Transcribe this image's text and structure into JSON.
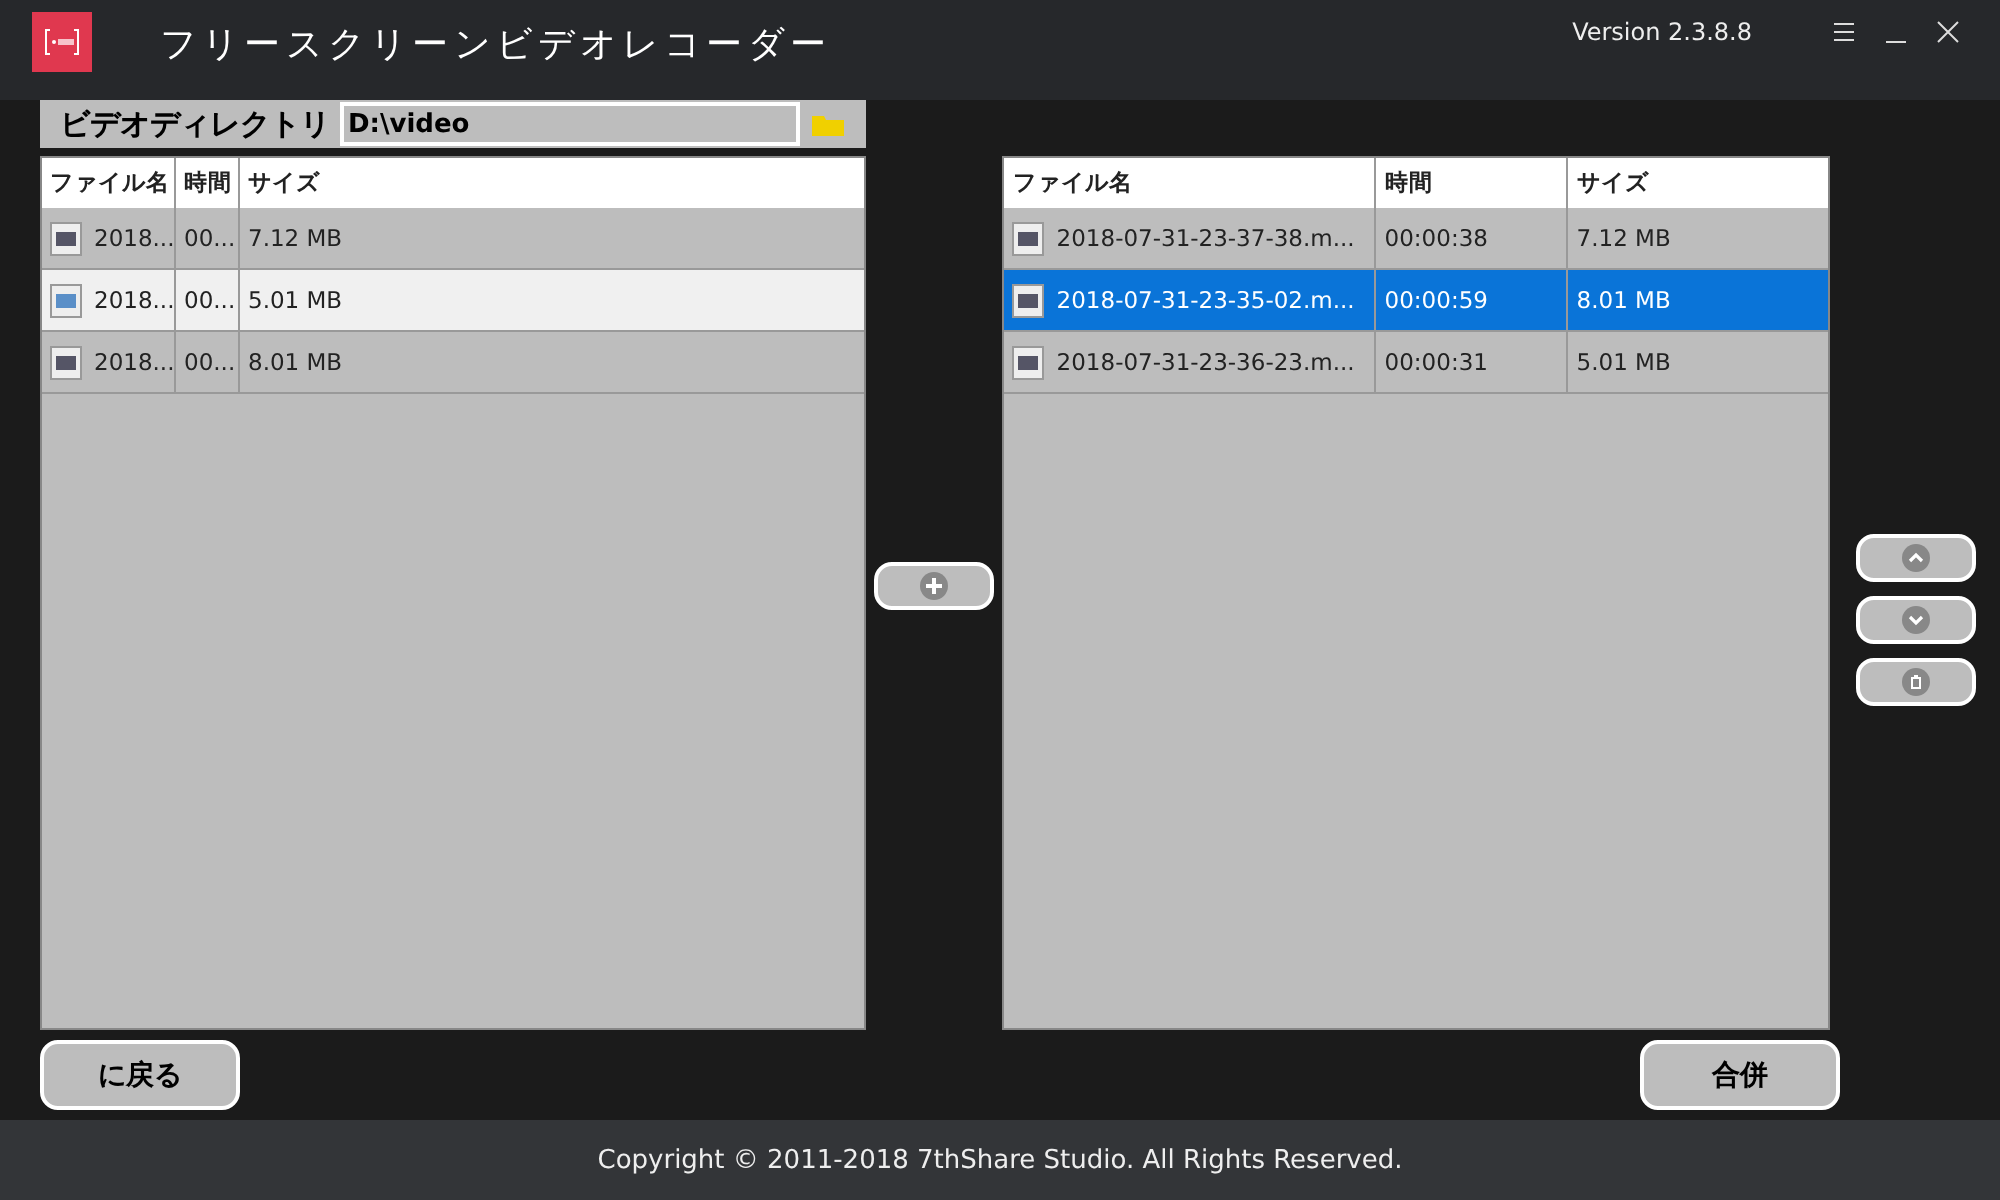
{
  "window": {
    "title": "フリースクリーンビデオレコーダー",
    "version": "Version 2.3.8.8"
  },
  "directory": {
    "label": "ビデオディレクトリ",
    "value": "D:\\video"
  },
  "source_table": {
    "columns": [
      "ファイル名",
      "時間",
      "サイズ"
    ],
    "rows": [
      {
        "name": "2018...",
        "time": "00...",
        "size": "7.12 MB",
        "selected": false
      },
      {
        "name": "2018...",
        "time": "00...",
        "size": "5.01 MB",
        "selected": true
      },
      {
        "name": "2018...",
        "time": "00...",
        "size": "8.01 MB",
        "selected": false
      }
    ]
  },
  "merge_table": {
    "columns": [
      "ファイル名",
      "時間",
      "サイズ"
    ],
    "rows": [
      {
        "name": "2018-07-31-23-37-38.m...",
        "time": "00:00:38",
        "size": "7.12 MB",
        "selected": false
      },
      {
        "name": "2018-07-31-23-35-02.m...",
        "time": "00:00:59",
        "size": "8.01 MB",
        "selected": true
      },
      {
        "name": "2018-07-31-23-36-23.m...",
        "time": "00:00:31",
        "size": "5.01 MB",
        "selected": false
      }
    ]
  },
  "buttons": {
    "back": "に戻る",
    "merge": "合併"
  },
  "footer": "Copyright © 2011-2018 7thShare Studio. All Rights Reserved."
}
